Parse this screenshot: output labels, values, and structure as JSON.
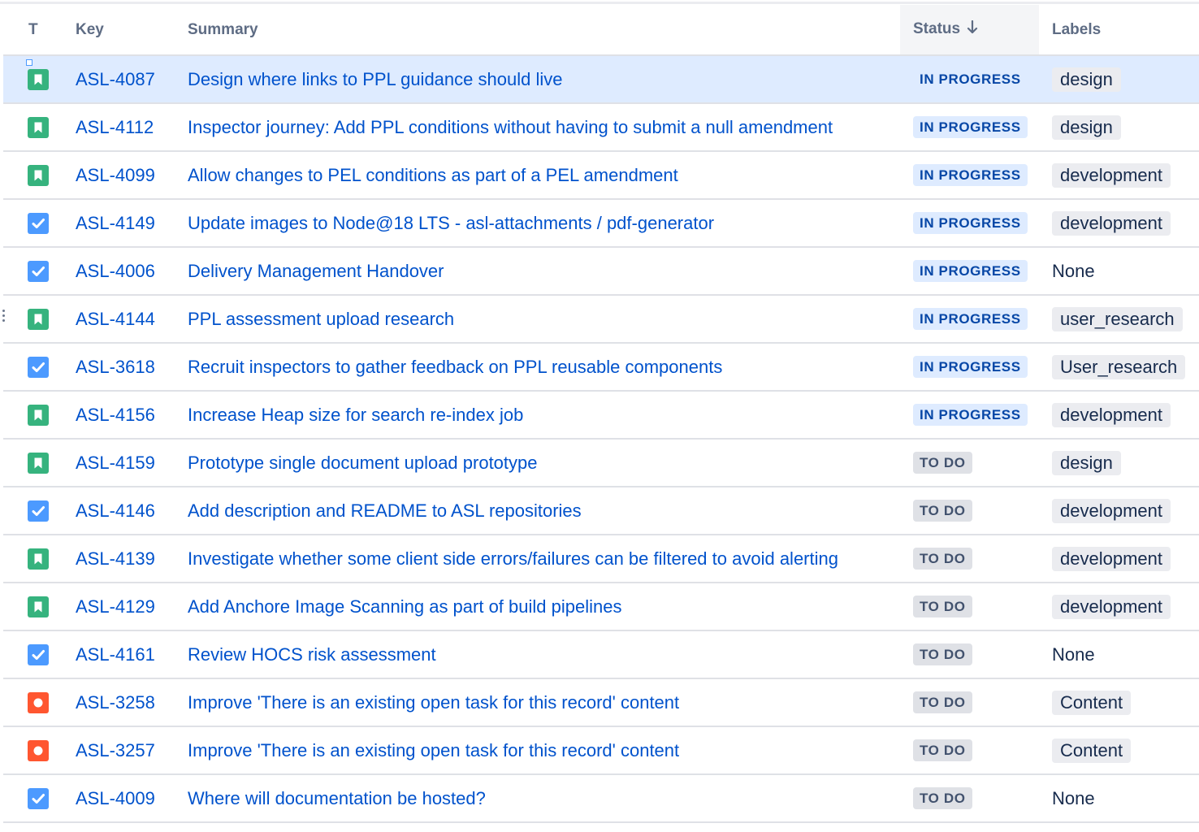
{
  "columns": {
    "type": "T",
    "key": "Key",
    "summary": "Summary",
    "status": "Status",
    "labels": "Labels"
  },
  "colors": {
    "link": "#0052cc",
    "story": "#36b37e",
    "task": "#4c9aff",
    "bug": "#ff5630",
    "in_progress_bg": "#deebff",
    "todo_bg": "#dfe1e6",
    "selected_row": "#deebff"
  },
  "rows": [
    {
      "type": "story-icon",
      "key": "ASL-4087",
      "summary": "Design where links to PPL guidance should live",
      "status": "IN PROGRESS",
      "label": "design"
    },
    {
      "type": "story-icon",
      "key": "ASL-4112",
      "summary": "Inspector journey: Add PPL conditions without having to submit a null amendment",
      "status": "IN PROGRESS",
      "label": "design"
    },
    {
      "type": "story-icon",
      "key": "ASL-4099",
      "summary": "Allow changes to PEL conditions as part of a PEL amendment",
      "status": "IN PROGRESS",
      "label": "development"
    },
    {
      "type": "task-icon",
      "key": "ASL-4149",
      "summary": "Update images to Node@18 LTS - asl-attachments / pdf-generator",
      "status": "IN PROGRESS",
      "label": "development"
    },
    {
      "type": "task-icon",
      "key": "ASL-4006",
      "summary": "Delivery Management Handover",
      "status": "IN PROGRESS",
      "label": "None"
    },
    {
      "type": "story-icon",
      "key": "ASL-4144",
      "summary": "PPL assessment upload research",
      "status": "IN PROGRESS",
      "label": "user_research"
    },
    {
      "type": "task-icon",
      "key": "ASL-3618",
      "summary": "Recruit inspectors to gather feedback on PPL reusable components",
      "status": "IN PROGRESS",
      "label": "User_research"
    },
    {
      "type": "story-icon",
      "key": "ASL-4156",
      "summary": "Increase Heap size for search re-index job",
      "status": "IN PROGRESS",
      "label": "development"
    },
    {
      "type": "story-icon",
      "key": "ASL-4159",
      "summary": "Prototype single document upload prototype",
      "status": "TO DO",
      "label": "design"
    },
    {
      "type": "task-icon",
      "key": "ASL-4146",
      "summary": "Add description and README to ASL repositories",
      "status": "TO DO",
      "label": "development"
    },
    {
      "type": "story-icon",
      "key": "ASL-4139",
      "summary": "Investigate whether some client side errors/failures can be filtered to avoid alerting",
      "status": "TO DO",
      "label": "development"
    },
    {
      "type": "story-icon",
      "key": "ASL-4129",
      "summary": "Add Anchore Image Scanning as part of build pipelines",
      "status": "TO DO",
      "label": "development"
    },
    {
      "type": "task-icon",
      "key": "ASL-4161",
      "summary": "Review HOCS risk assessment",
      "status": "TO DO",
      "label": "None"
    },
    {
      "type": "bug-icon",
      "key": "ASL-3258",
      "summary": "Improve 'There is an existing open task for this record' content",
      "status": "TO DO",
      "label": "Content"
    },
    {
      "type": "bug-icon",
      "key": "ASL-3257",
      "summary": "Improve 'There is an existing open task for this record' content",
      "status": "TO DO",
      "label": "Content"
    },
    {
      "type": "task-icon",
      "key": "ASL-4009",
      "summary": "Where will documentation be hosted?",
      "status": "TO DO",
      "label": "None"
    }
  ]
}
